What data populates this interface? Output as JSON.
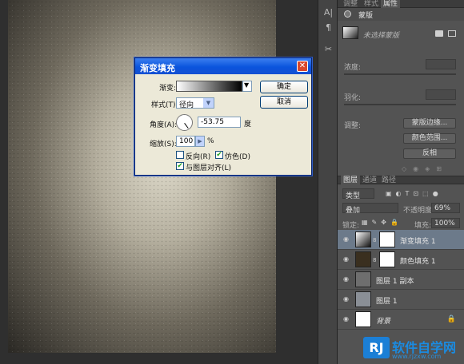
{
  "properties_panel": {
    "tabs": [
      "调整",
      "样式",
      "属性"
    ],
    "header_title": "蒙版",
    "mask_label": "未选择蒙版",
    "density_label": "浓度:",
    "feather_label": "羽化:",
    "refine_label": "调整:",
    "buttons": [
      "蒙版边缘...",
      "颜色范围...",
      "反相"
    ]
  },
  "layers_panel": {
    "tabs": [
      "图层",
      "通道",
      "路径"
    ],
    "filter_kind": "类型",
    "blend_mode": "叠加",
    "opacity_label": "不透明度:",
    "opacity_value": "69%",
    "lock_label": "锁定:",
    "fill_label": "填充:",
    "fill_value": "100%",
    "layers": [
      {
        "name": "渐变填充 1",
        "selected": true
      },
      {
        "name": "颜色填充 1",
        "selected": false
      },
      {
        "name": "图层 1 副本",
        "selected": false
      },
      {
        "name": "图层 1",
        "selected": false
      },
      {
        "name": "背景",
        "selected": false,
        "locked": true
      }
    ]
  },
  "dialog": {
    "title": "渐变填充",
    "gradient_label": "渐变:",
    "style_label": "样式(T):",
    "style_value": "径向",
    "angle_label": "角度(A):",
    "angle_value": "-53.75",
    "angle_unit": "度",
    "scale_label": "缩放(S):",
    "scale_value": "100",
    "scale_unit": "%",
    "reverse_label": "反向(R)",
    "reverse_checked": false,
    "dither_label": "仿色(D)",
    "dither_checked": true,
    "align_label": "与图层对齐(L)",
    "align_checked": true,
    "ok_label": "确定",
    "cancel_label": "取消",
    "close_glyph": "✕"
  },
  "watermark": {
    "logo": "RJ",
    "text": "软件自学网",
    "url": "www.rjzxw.com"
  }
}
